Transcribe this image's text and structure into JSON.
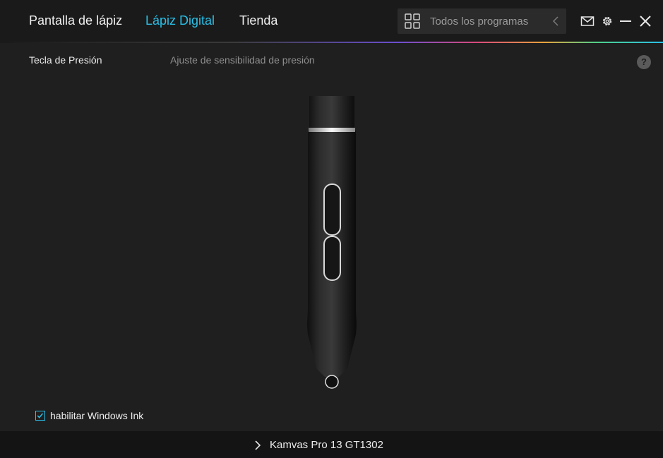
{
  "nav": {
    "tabs": [
      {
        "label": "Pantalla de lápiz"
      },
      {
        "label": "Lápiz Digital"
      },
      {
        "label": "Tienda"
      }
    ],
    "active_tab_color": "#2ac0e8"
  },
  "program_selector": {
    "value": "Todos los programas"
  },
  "window_controls": [
    "mail-icon",
    "gear-icon",
    "minimize-icon",
    "close-icon"
  ],
  "subtabs": [
    {
      "label": "Tecla de Presión"
    },
    {
      "label": "Ajuste de sensibilidad de presión"
    }
  ],
  "help": {
    "label": "?"
  },
  "windows_ink": {
    "label": "habilitar Windows Ink",
    "checked": true
  },
  "device": {
    "name": "Kamvas Pro 13 GT1302"
  }
}
